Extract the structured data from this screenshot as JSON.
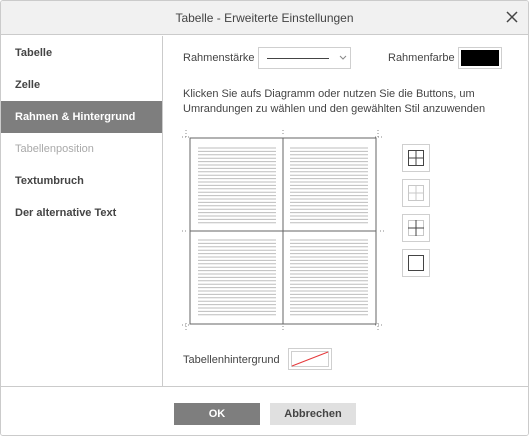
{
  "dialog": {
    "title": "Tabelle - Erweiterte Einstellungen"
  },
  "sidebar": {
    "items": [
      {
        "label": "Tabelle",
        "state": "normal"
      },
      {
        "label": "Zelle",
        "state": "normal"
      },
      {
        "label": "Rahmen & Hintergrund",
        "state": "active"
      },
      {
        "label": "Tabellenposition",
        "state": "disabled"
      },
      {
        "label": "Textumbruch",
        "state": "normal"
      },
      {
        "label": "Der alternative Text",
        "state": "normal"
      }
    ]
  },
  "borders": {
    "width_label": "Rahmenstärke",
    "color_label": "Rahmenfarbe",
    "color_value": "#000000",
    "hint": "Klicken Sie aufs Diagramm oder nutzen Sie die Buttons, um Umrandungen zu wählen und den gewählten Stil anzuwenden",
    "preset_buttons": [
      "all-borders-icon",
      "no-borders-icon",
      "inner-borders-icon",
      "outer-borders-icon"
    ]
  },
  "background": {
    "label": "Tabellenhintergrund",
    "value": "none"
  },
  "footer": {
    "ok_label": "OK",
    "cancel_label": "Abbrechen"
  },
  "colors": {
    "accent": "#7e7e7e",
    "border": "#cbcbcb",
    "swatch_none_line": "#e5393b"
  }
}
